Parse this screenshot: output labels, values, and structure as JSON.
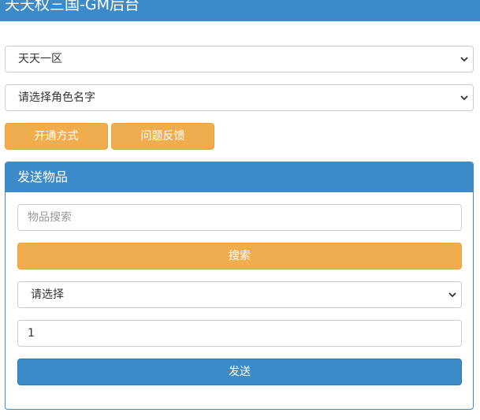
{
  "header": {
    "title": "天天权三国-GM后台"
  },
  "server_select": {
    "value": "天天一区"
  },
  "role_select": {
    "value": "请选择角色名字"
  },
  "buttons": {
    "open_method": "开通方式",
    "feedback": "问题反馈"
  },
  "send_panel": {
    "title": "发送物品",
    "search_input": {
      "placeholder": "物品搜索",
      "value": ""
    },
    "search_button": "搜索",
    "item_select": {
      "value": "请选择"
    },
    "quantity_input": {
      "value": "1"
    },
    "send_button": "发送"
  },
  "colors": {
    "primary_blue": "#3d8ac9",
    "accent_orange": "#f0ad4e"
  },
  "icons": {
    "select_arrow": "chevron-down-icon"
  }
}
